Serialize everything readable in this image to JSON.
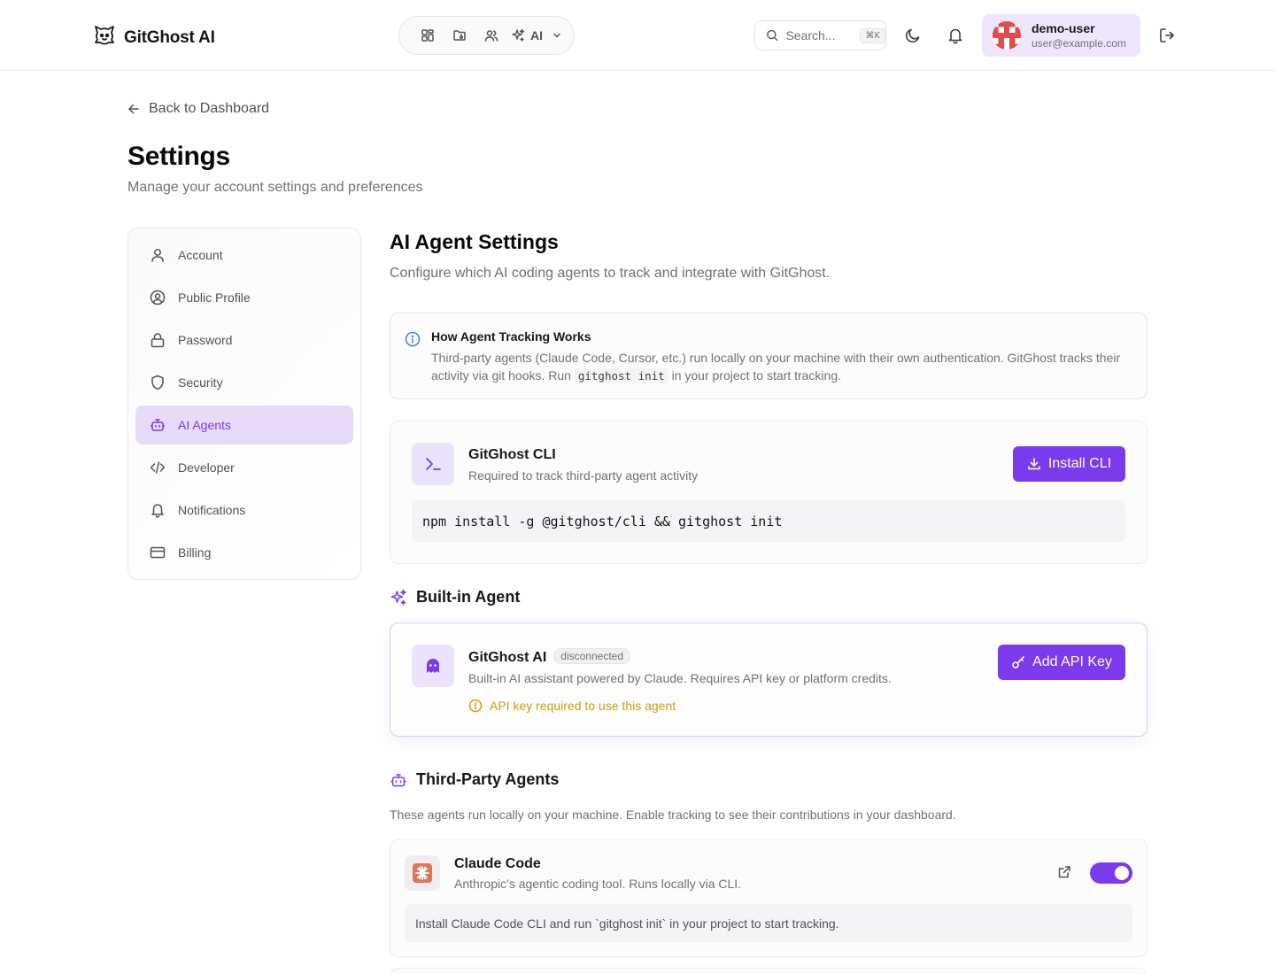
{
  "header": {
    "brand": "GitGhost AI",
    "nav_ai_label": "AI",
    "search_placeholder": "Search...",
    "search_shortcut": "⌘K",
    "user": {
      "name": "demo-user",
      "email": "user@example.com"
    }
  },
  "page": {
    "back_label": "Back to Dashboard",
    "title": "Settings",
    "subtitle": "Manage your account settings and preferences"
  },
  "sidebar": {
    "items": [
      {
        "label": "Account",
        "icon": "user-icon"
      },
      {
        "label": "Public Profile",
        "icon": "user-circle-icon"
      },
      {
        "label": "Password",
        "icon": "lock-icon"
      },
      {
        "label": "Security",
        "icon": "shield-icon"
      },
      {
        "label": "AI Agents",
        "icon": "bot-icon",
        "active": true
      },
      {
        "label": "Developer",
        "icon": "code-icon"
      },
      {
        "label": "Notifications",
        "icon": "bell-icon"
      },
      {
        "label": "Billing",
        "icon": "credit-card-icon"
      }
    ]
  },
  "main": {
    "title": "AI Agent Settings",
    "subtitle": "Configure which AI coding agents to track and integrate with GitGhost.",
    "info": {
      "title": "How Agent Tracking Works",
      "text_before": "Third-party agents (Claude Code, Cursor, etc.) run locally on your machine with their own authentication. GitGhost tracks their activity via git hooks. Run ",
      "code": "gitghost init",
      "text_after": " in your project to start tracking."
    },
    "cli": {
      "title": "GitGhost CLI",
      "subtitle": "Required to track third-party agent activity",
      "button": "Install CLI",
      "command": "npm install -g @gitghost/cli && gitghost init"
    },
    "builtin": {
      "heading": "Built-in Agent",
      "name": "GitGhost AI",
      "status": "disconnected",
      "description": "Built-in AI assistant powered by Claude. Requires API key or platform credits.",
      "warning": "API key required to use this agent",
      "button": "Add API Key"
    },
    "third_party": {
      "heading": "Third-Party Agents",
      "subtitle": "These agents run locally on your machine. Enable tracking to see their contributions in your dashboard.",
      "agents": [
        {
          "name": "Claude Code",
          "description": "Anthropic's agentic coding tool. Runs locally via CLI.",
          "enabled": true,
          "hint": "Install Claude Code CLI and run `gitghost init` in your project to start tracking."
        }
      ]
    }
  },
  "colors": {
    "accent": "#7c3aed",
    "accent_soft": "#e6dcfa",
    "warning": "#d19e07",
    "info": "#3b82f6",
    "claude": "#d97757"
  }
}
